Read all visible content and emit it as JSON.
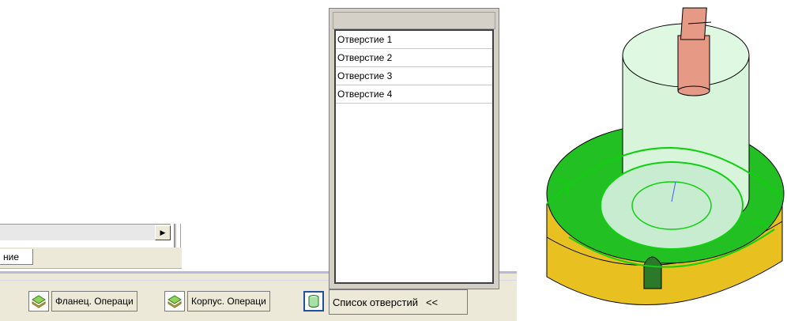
{
  "left_panel": {
    "tab_label": "ние",
    "scroll_right_glyph": "▶"
  },
  "taskbar": {
    "tabs": [
      {
        "icon": "layers-icon",
        "label": "Фланец. Операци"
      },
      {
        "icon": "layers-icon",
        "label": "Корпус. Операци"
      }
    ],
    "active_icon": "cylinder-icon"
  },
  "hole_list": {
    "title": "Список отверстий",
    "collapse_label": "<<",
    "items": [
      "Отверстие 1",
      "Отверстие 2",
      "Отверстие 3",
      "Отверстие 4"
    ]
  },
  "colors": {
    "flange_green": "#22c022",
    "body_light_green": "#d8f5dc",
    "shaft_salmon": "#e69a86",
    "base_yellow": "#e8c020"
  }
}
